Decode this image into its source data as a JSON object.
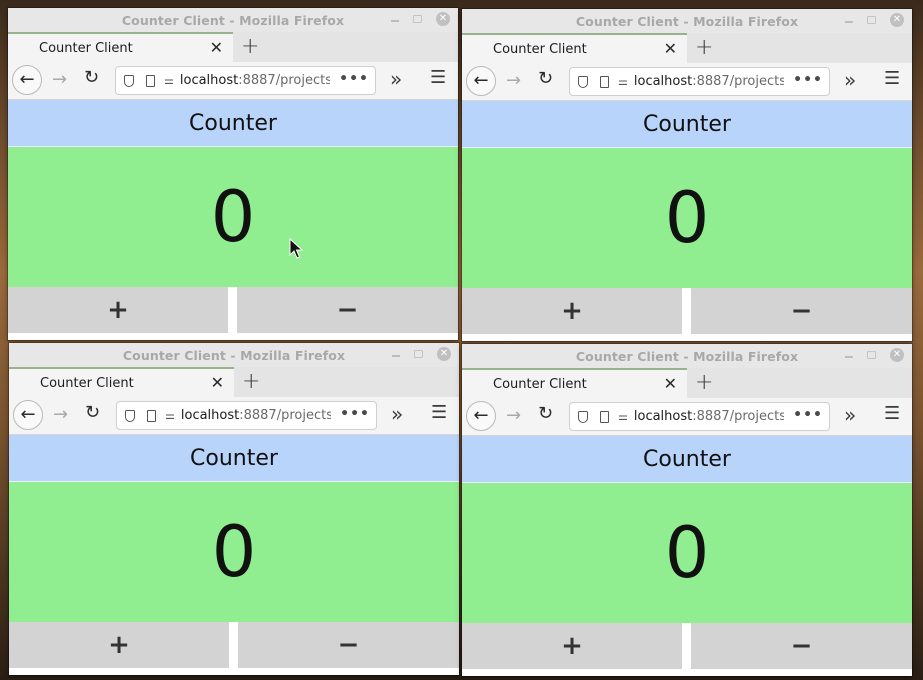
{
  "windows": [
    {
      "id": "window-top-left",
      "title": "Counter Client - Mozilla Firefox",
      "tab": "Counter Client",
      "url_host": "localhost",
      "url_rest": ":8887/projects",
      "header": "Counter",
      "count": "0",
      "inc": "+",
      "dec": "−"
    },
    {
      "id": "window-top-right",
      "title": "Counter Client - Mozilla Firefox",
      "tab": "Counter Client",
      "url_host": "localhost",
      "url_rest": ":8887/projects",
      "header": "Counter",
      "count": "0",
      "inc": "+",
      "dec": "−"
    },
    {
      "id": "window-bottom-left",
      "title": "Counter Client - Mozilla Firefox",
      "tab": "Counter Client",
      "url_host": "localhost",
      "url_rest": ":8887/projects",
      "header": "Counter",
      "count": "0",
      "inc": "+",
      "dec": "−"
    },
    {
      "id": "window-bottom-right",
      "title": "Counter Client - Mozilla Firefox",
      "tab": "Counter Client",
      "url_host": "localhost",
      "url_rest": ":8887/projects",
      "header": "Counter",
      "count": "0",
      "inc": "+",
      "dec": "−"
    }
  ],
  "icons": {
    "minimize": "minimize-icon",
    "maximize": "maximize-icon",
    "close": "close-icon",
    "tab_close": "tab-close-icon",
    "new_tab": "plus-icon",
    "back": "back-arrow-icon",
    "forward": "forward-arrow-icon",
    "reload": "reload-icon",
    "shield": "shield-icon",
    "page": "page-icon",
    "permissions": "permissions-icon",
    "page_actions": "more-icon",
    "overflow": "chevron-double-right-icon",
    "menu": "hamburger-menu-icon"
  },
  "colors": {
    "header_bg": "#b9d4fb",
    "counter_bg": "#90ee90",
    "button_bg": "#d3d3d3",
    "tab_accent": "#97b38b"
  }
}
